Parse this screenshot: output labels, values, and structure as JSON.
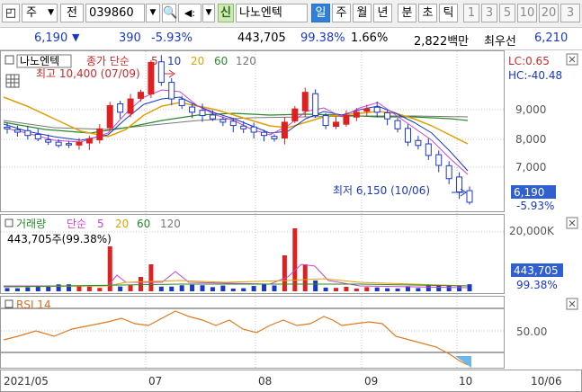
{
  "toolbar": {
    "type_label": "주",
    "jeon_label": "전",
    "code": "039860",
    "sin_label": "신",
    "name": "나노엔텍",
    "periods": [
      "일",
      "주",
      "월",
      "년",
      "분",
      "초",
      "틱"
    ],
    "minutes": [
      "1",
      "3",
      "5",
      "10",
      "20",
      "3"
    ]
  },
  "quote": {
    "price": "6,190",
    "change": "390",
    "rate": "-5.93%",
    "volume": "443,705",
    "vol_ratio": "99.38%",
    "turnover": "1.66%",
    "amount": "2,822백만",
    "priority_label": "최우선",
    "priority_price": "6,210"
  },
  "price_panel": {
    "name": "나노엔텍",
    "legend_prefix": "종가 단순",
    "ma": [
      "5",
      "10",
      "20",
      "60",
      "120"
    ],
    "high_label": "최고 10,400 (07/09)",
    "low_label": "최저 6,150 (10/06)",
    "lc": "LC:0.65",
    "hc": "HC:-40.48",
    "price_tag": "6,190",
    "rate_tag": "-5.93%",
    "y_ticks": [
      "9,000",
      "8,000",
      "7,000"
    ]
  },
  "volume_panel": {
    "title": "거래량",
    "legend_prefix": "단순",
    "ma": [
      "5",
      "20",
      "60",
      "120"
    ],
    "value_label": "443,705주(99.38%)",
    "y_tick": "20,000K",
    "vol_tag": "443,705",
    "pct_tag": "99.38%"
  },
  "rsi_panel": {
    "title": "RSI 14",
    "y_tick": "50.00"
  },
  "x_axis": {
    "labels": [
      "2021/05",
      "07",
      "08",
      "09",
      "10"
    ],
    "end_label": "10/06"
  },
  "chart_data": {
    "type": "line",
    "x_start": "2021/05",
    "x_end": "10/06",
    "price_close_approx": [
      8400,
      8300,
      8200,
      8100,
      8000,
      7900,
      7950,
      8000,
      8100,
      8400,
      9100,
      8900,
      9300,
      9500,
      10400,
      9800,
      9300,
      9100,
      8900,
      8800,
      8700,
      8600,
      8500,
      8400,
      8300,
      8200,
      8100,
      8600,
      9000,
      9500,
      8800,
      8500,
      8600,
      8800,
      8900,
      9000,
      8900,
      8700,
      8400,
      8000,
      7900,
      7600,
      7300,
      6900,
      6500,
      6190
    ],
    "price_ylim": [
      6000,
      10600
    ],
    "rsi_ylim": [
      0,
      100
    ]
  }
}
